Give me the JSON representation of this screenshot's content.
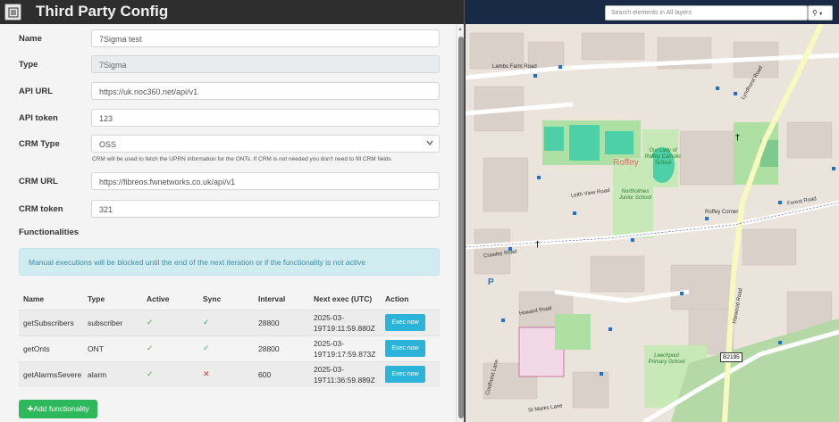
{
  "header": {
    "title": "Third Party Config"
  },
  "form": {
    "name_label": "Name",
    "name_value": "7Sigma test",
    "type_label": "Type",
    "type_value": "7Sigma",
    "api_url_label": "API URL",
    "api_url_value": "https://uk.noc360.net/api/v1",
    "api_token_label": "API token",
    "api_token_value": "123",
    "crm_type_label": "CRM Type",
    "crm_type_value": "OSS",
    "crm_help": "CRM will be used to fetch the UPRN information for the ONTs. If CRM is not needed you don't need to fill CRM fields",
    "crm_url_label": "CRM URL",
    "crm_url_value": "https://fibreos.fwnetworks.co.uk/api/v1",
    "crm_token_label": "CRM token",
    "crm_token_value": "321"
  },
  "functionalities": {
    "title": "Functionalities",
    "alert": "Manual executions will be blocked until the end of the next iteration or if the functionality is not active",
    "columns": [
      "Name",
      "Type",
      "Active",
      "Sync",
      "Interval",
      "Next exec (UTC)",
      "Action"
    ],
    "rows": [
      {
        "name": "getSubscribers",
        "type": "subscriber",
        "active": "✓",
        "sync": "✓",
        "interval": "28800",
        "next_exec": "2025-03-19T19:11:59.880Z",
        "action": "Exec now"
      },
      {
        "name": "getOnts",
        "type": "ONT",
        "active": "✓",
        "sync": "✓",
        "interval": "28800",
        "next_exec": "2025-03-19T19:17:59.873Z",
        "action": "Exec now"
      },
      {
        "name": "getAlarmsSevere",
        "type": "alarm",
        "active": "✓",
        "sync": "✕",
        "interval": "600",
        "next_exec": "2025-03-19T11:36:59.889Z",
        "action": "Exec now"
      }
    ],
    "add_button": "Add functionality"
  },
  "map": {
    "search_placeholder": "Search elements in All layers",
    "labels": {
      "roffey": "Roffey",
      "roffey_corner": "Roffey Corner",
      "crawley_road": "Crawley Road",
      "lambs_farm_road": "Lambs Farm Road",
      "leith_view_road": "Leith View Road",
      "lyndhurst_road": "Lyndhurst Road",
      "forest_road": "Forest Road",
      "howard_road": "Howard Road",
      "harwood_road": "Harwood Road",
      "coolhurst_lane": "Coolhurst Lane",
      "st_marks_lane": "St Marks Lane",
      "b2195": "B2195",
      "school1": "Our Lady of Roffey Catholic School",
      "school2": "Northolmes Junior School",
      "school3": "Leechpool Primary School"
    }
  }
}
